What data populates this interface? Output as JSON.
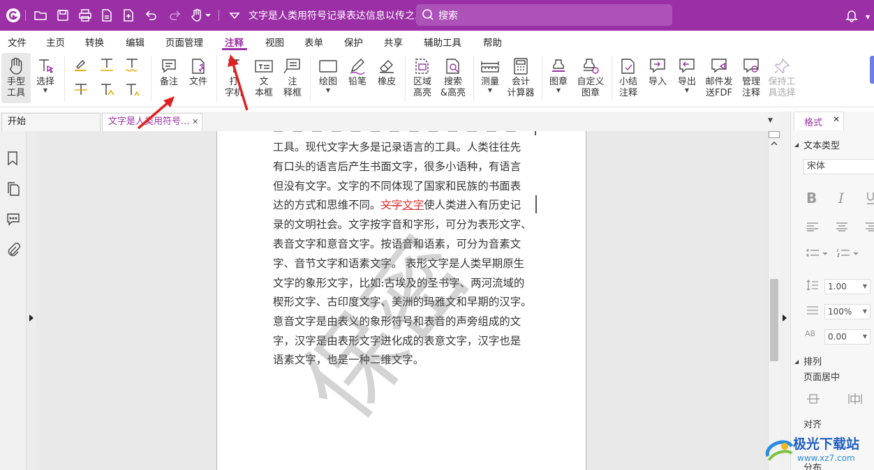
{
  "titlebar": {
    "doc_title": "文字是人类用符号记录表达信息以传之...",
    "search_placeholder": "搜索"
  },
  "menu": {
    "items": [
      "文件",
      "主页",
      "转换",
      "编辑",
      "页面管理",
      "注释",
      "视图",
      "表单",
      "保护",
      "共享",
      "辅助工具",
      "帮助"
    ],
    "active": "注释"
  },
  "ribbon": {
    "hand_tool": [
      "手型",
      "工具"
    ],
    "select": "选择",
    "note": "备注",
    "file": "文件",
    "typewriter": [
      "打",
      "字机"
    ],
    "textbox": [
      "文",
      "本框"
    ],
    "callout": [
      "注",
      "释框"
    ],
    "draw": "绘图",
    "pencil": "铅笔",
    "eraser": "橡皮",
    "area_highlight": [
      "区域",
      "高亮"
    ],
    "search_highlight": [
      "搜索",
      "&高亮"
    ],
    "measure": "测量",
    "accounting_calc": [
      "会计",
      "计算器"
    ],
    "stamp": "图章",
    "custom_stamp": [
      "自定义",
      "图章"
    ],
    "summary_comments": [
      "小结",
      "注释"
    ],
    "import": "导入",
    "export": "导出",
    "email_fdf": [
      "邮件发",
      "送FDF"
    ],
    "manage_comments": [
      "管理",
      "注释"
    ],
    "keep_tool_selected": [
      "保持工",
      "具选择"
    ]
  },
  "tabs": {
    "start": "开始",
    "doc": "文字是人类用符号...",
    "close": "✕"
  },
  "document": {
    "lines": [
      "工具。现代文字大多是记录语言的工具。人类往往先",
      "有口头的语言后产生书面文字，很多小语种，有语言",
      "但没有文字。文字的不同体现了国家和民族的书面表",
      "录的文明社会。文字按字音和字形，可分为表形文字、",
      "表音文字和意音文字。按语音和语素，可分为音素文",
      "字、音节文字和语素文字。 表形文字是人类早期原生",
      "文字的象形文字，比如:古埃及的圣书字、两河流域的",
      "楔形文字、古印度文字、美洲的玛雅文和早期的汉字。",
      "意音文字是由表义的象形符号和表音的声旁组成的文",
      "字，汉字是由表形文字进化成的表意文字，汉字也是",
      "语素文字，也是一种二维文字。"
    ],
    "line4_pre": "达的方式和思维不同。",
    "line4_strike": "文字",
    "line4_insert": "文字",
    "line4_post": "使人类进入有历史记",
    "watermark": "保密"
  },
  "format_panel": {
    "tab": "格式",
    "text_type": "文本类型",
    "font": "宋体",
    "line_spacing": "1.00",
    "scale": "100%",
    "char_spacing": "0.00",
    "arrange": "排列",
    "page_center": "页面居中",
    "align": "对齐",
    "distribute": "分布"
  },
  "brand": {
    "name": "极光下载站",
    "url": "www.xz7.com"
  },
  "colors": {
    "accent": "#9a2fa6",
    "arrow": "#e02020",
    "strike": "#e03030"
  }
}
